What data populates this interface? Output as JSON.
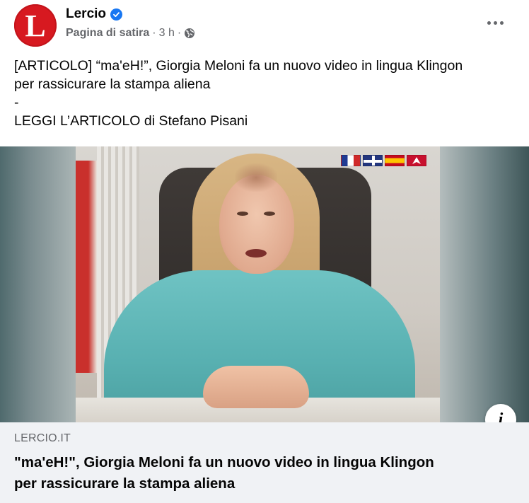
{
  "header": {
    "avatar_letter": "L",
    "page_name": "Lercio",
    "verified": true,
    "category": "Pagina di satira",
    "separator": "·",
    "time": "3 h",
    "privacy_icon": "globe-icon",
    "more_icon": "more-options-icon"
  },
  "post": {
    "lines": [
      "[ARTICOLO] “ma'eH!”, Giorgia Meloni fa un nuovo video in lingua Klingon",
      "per rassicurare la stampa aliena",
      "-",
      "LEGGI L’ARTICOLO di Stefano Pisani"
    ]
  },
  "media": {
    "info_icon": "info-icon",
    "info_label": "i"
  },
  "link_preview": {
    "domain": "LERCIO.IT",
    "title_lines": [
      "\"ma'eH!\", Giorgia Meloni fa un nuovo video in lingua Klingon",
      "per rassicurare la stampa aliena"
    ]
  },
  "colors": {
    "brand_red": "#d71920",
    "verified_blue": "#1877f2",
    "secondary_text": "#65676b",
    "preview_bg": "#f0f2f5"
  }
}
